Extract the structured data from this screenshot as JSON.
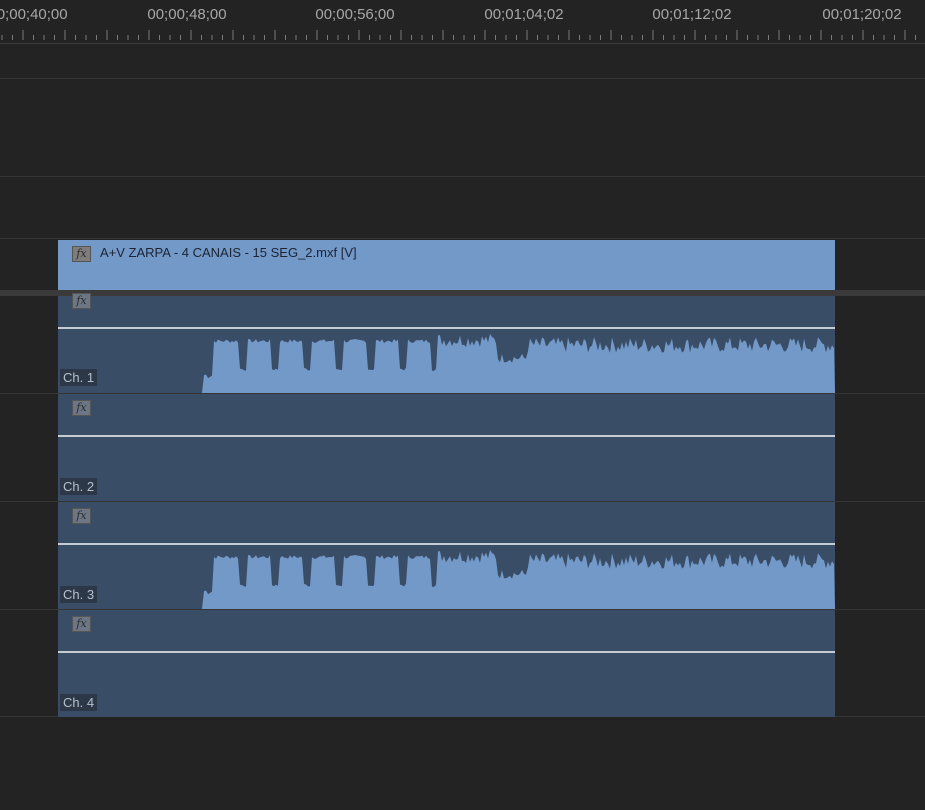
{
  "ruler": {
    "labels": [
      "00;00;40;00",
      "00;00;48;00",
      "00;00;56;00",
      "00;01;04;02",
      "00;01;12;02",
      "00;01;20;02"
    ]
  },
  "video_clip": {
    "title": "A+V ZARPA - 4 CANAIS - 15 SEG_2.mxf [V]",
    "fx_label": "fx"
  },
  "audio_channels": [
    {
      "label": "Ch. 1",
      "fx_label": "fx",
      "has_waveform": true
    },
    {
      "label": "Ch. 2",
      "fx_label": "fx",
      "has_waveform": false
    },
    {
      "label": "Ch. 3",
      "fx_label": "fx",
      "has_waveform": true
    },
    {
      "label": "Ch. 4",
      "fx_label": "fx",
      "has_waveform": false
    }
  ],
  "colors": {
    "video_clip": "#7399c9",
    "audio_clip": "#3a4d66",
    "waveform": "#7399c9",
    "background": "#232323"
  }
}
